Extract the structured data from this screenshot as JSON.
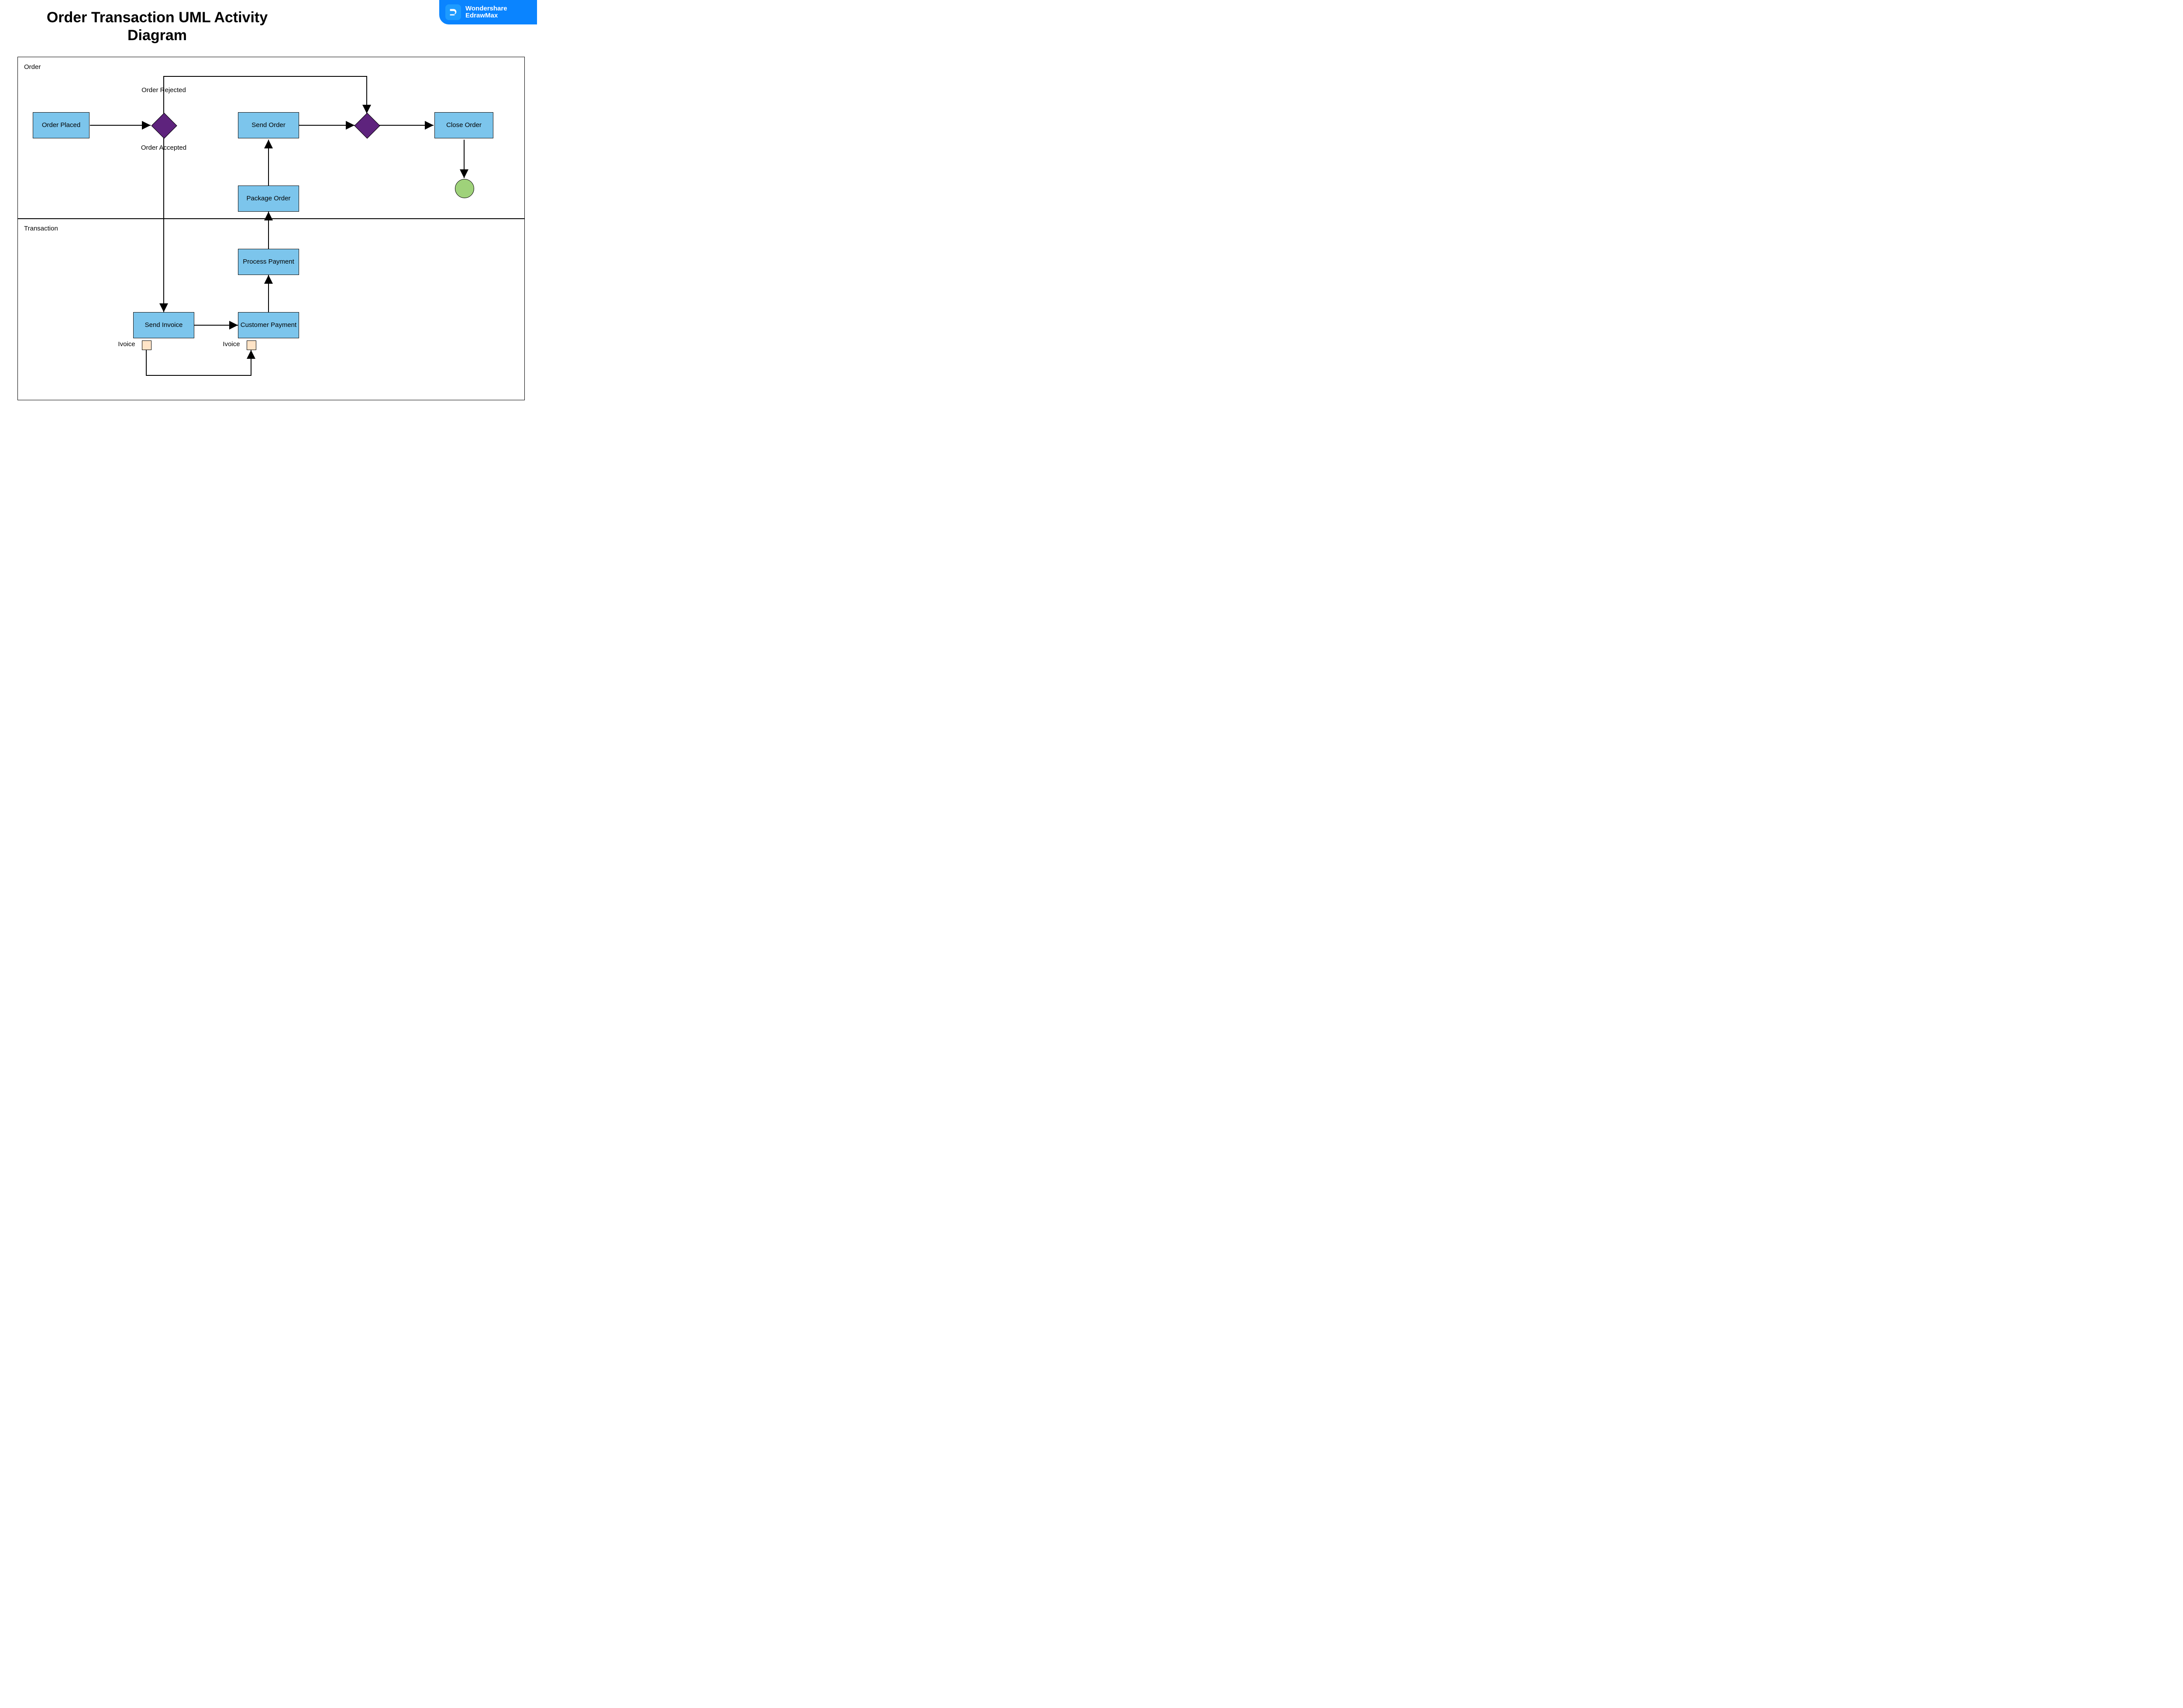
{
  "title": "Order Transaction UML Activity Diagram",
  "badge": {
    "line1": "Wondershare",
    "line2": "EdrawMax"
  },
  "lanes": {
    "order": "Order",
    "transaction": "Transaction"
  },
  "nodes": {
    "order_placed": "Order Placed",
    "send_order": "Send Order",
    "close_order": "Close Order",
    "package_order": "Package Order",
    "process_payment": "Process Payment",
    "send_invoice": "Send Invoice",
    "customer_payment": "Customer Payment"
  },
  "edge_labels": {
    "order_rejected": "Order Rejected",
    "order_accepted": "Order Accepted",
    "invoice_a": "Ivoice",
    "invoice_b": "Ivoice"
  },
  "chart_data": {
    "type": "uml-activity",
    "swimlanes": [
      "Order",
      "Transaction"
    ],
    "activities": [
      {
        "id": "order_placed",
        "label": "Order Placed",
        "lane": "Order"
      },
      {
        "id": "decision1",
        "kind": "decision",
        "lane": "Order"
      },
      {
        "id": "send_order",
        "label": "Send Order",
        "lane": "Order"
      },
      {
        "id": "merge1",
        "kind": "merge",
        "lane": "Order"
      },
      {
        "id": "close_order",
        "label": "Close Order",
        "lane": "Order"
      },
      {
        "id": "end",
        "kind": "final",
        "lane": "Order"
      },
      {
        "id": "package_order",
        "label": "Package Order",
        "lane": "Order"
      },
      {
        "id": "process_payment",
        "label": "Process Payment",
        "lane": "Transaction"
      },
      {
        "id": "send_invoice",
        "label": "Send Invoice",
        "lane": "Transaction"
      },
      {
        "id": "customer_payment",
        "label": "Customer Payment",
        "lane": "Transaction"
      }
    ],
    "edges": [
      {
        "from": "order_placed",
        "to": "decision1"
      },
      {
        "from": "decision1",
        "to": "merge1",
        "label": "Order Rejected"
      },
      {
        "from": "decision1",
        "to": "send_invoice",
        "label": "Order Accepted"
      },
      {
        "from": "send_invoice",
        "to": "customer_payment"
      },
      {
        "from": "send_invoice",
        "to": "customer_payment",
        "object": "Ivoice"
      },
      {
        "from": "customer_payment",
        "to": "process_payment"
      },
      {
        "from": "process_payment",
        "to": "package_order"
      },
      {
        "from": "package_order",
        "to": "send_order"
      },
      {
        "from": "send_order",
        "to": "merge1"
      },
      {
        "from": "merge1",
        "to": "close_order"
      },
      {
        "from": "close_order",
        "to": "end"
      }
    ]
  }
}
